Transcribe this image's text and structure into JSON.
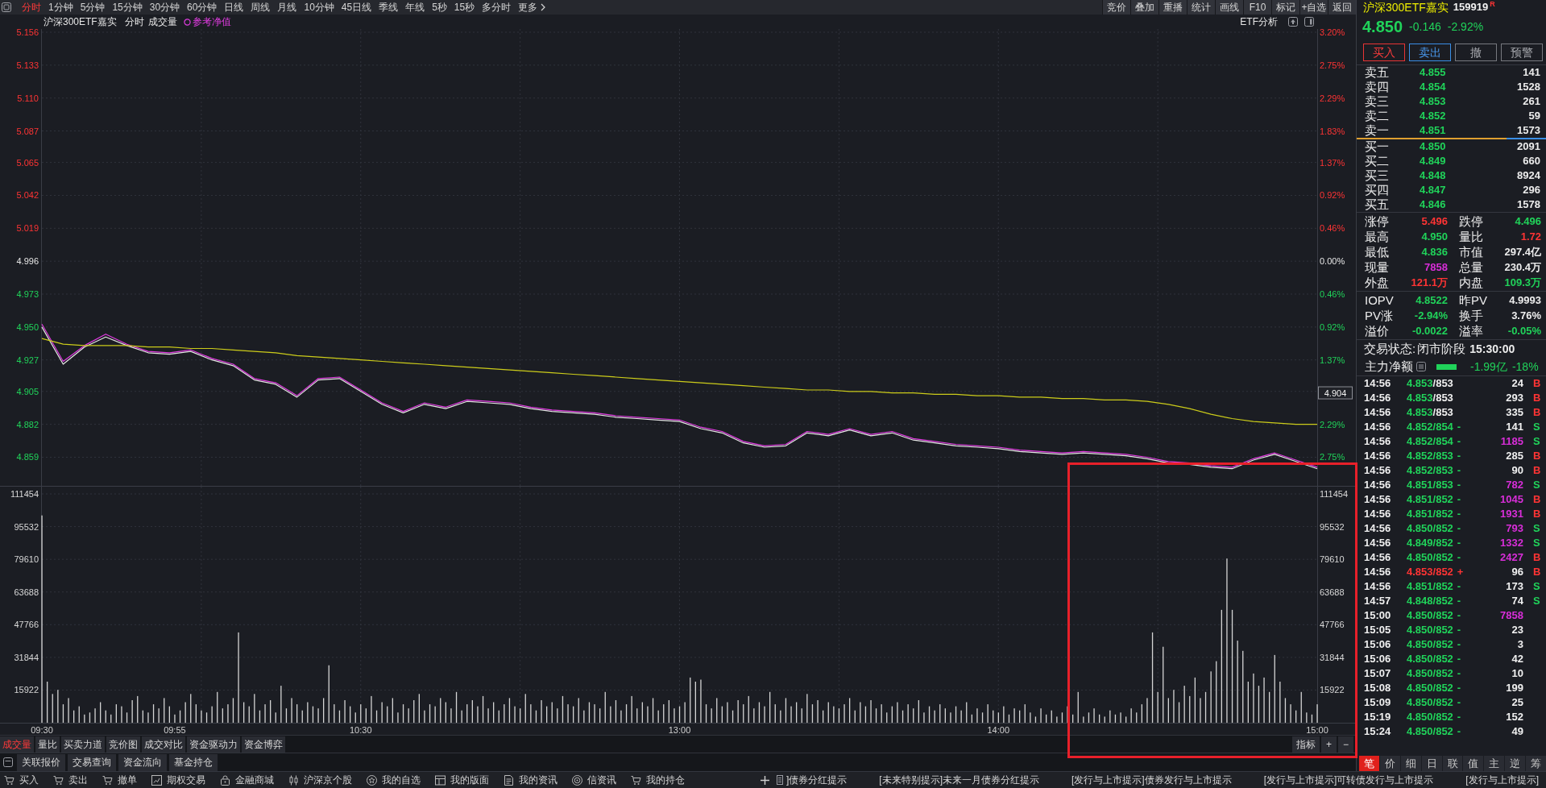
{
  "toolbar": {
    "periods": [
      {
        "label": "分时",
        "selected": true
      },
      {
        "label": "1分钟",
        "selected": false
      },
      {
        "label": "5分钟",
        "selected": false
      },
      {
        "label": "15分钟",
        "selected": false
      },
      {
        "label": "30分钟",
        "selected": false
      },
      {
        "label": "60分钟",
        "selected": false
      },
      {
        "label": "日线",
        "selected": false
      },
      {
        "label": "周线",
        "selected": false
      },
      {
        "label": "月线",
        "selected": false
      },
      {
        "label": "10分钟",
        "selected": false
      },
      {
        "label": "45日线",
        "selected": false
      },
      {
        "label": "季线",
        "selected": false
      },
      {
        "label": "年线",
        "selected": false
      },
      {
        "label": "5秒",
        "selected": false
      },
      {
        "label": "15秒",
        "selected": false
      },
      {
        "label": "多分时",
        "selected": false
      }
    ],
    "more": "更多",
    "actions": [
      "竞价",
      "叠加",
      "重播",
      "统计",
      "画线",
      "F10",
      "标记",
      "+自选",
      "返回"
    ]
  },
  "chart_header": {
    "security": "沪深300ETF嘉实",
    "mode": "分时",
    "analysis": "ETF分析"
  },
  "price_chart": {
    "chart_data": {
      "type": "line",
      "categories": [
        null,
        null,
        null,
        null,
        null,
        null,
        null,
        null,
        null,
        null,
        null,
        null,
        null,
        null,
        null,
        null,
        null,
        null,
        null,
        null,
        null,
        null,
        null,
        null,
        null,
        null,
        null,
        null,
        null,
        null,
        null,
        null,
        null,
        null,
        null,
        null,
        null,
        null,
        null,
        null,
        null,
        null,
        null,
        null,
        null,
        null,
        null,
        null,
        null,
        null,
        null,
        null,
        null,
        null,
        null,
        null,
        null,
        null,
        null,
        null,
        null
      ],
      "series": [
        {
          "color": "#e6e6e6",
          "values": [
            4.95,
            4.924,
            4.936,
            4.943,
            4.937,
            4.932,
            4.931,
            4.933,
            4.927,
            4.923,
            4.913,
            4.91,
            4.901,
            4.913,
            4.914,
            4.905,
            4.896,
            4.89,
            4.896,
            4.893,
            4.898,
            4.897,
            4.896,
            4.893,
            4.891,
            4.89,
            4.889,
            4.887,
            4.886,
            4.885,
            4.884,
            4.879,
            4.876,
            4.869,
            4.866,
            4.867,
            4.876,
            4.874,
            4.878,
            4.874,
            4.876,
            4.871,
            4.869,
            4.867,
            4.866,
            4.865,
            4.863,
            4.862,
            4.861,
            4.862,
            4.861,
            4.86,
            4.858,
            4.855,
            4.854,
            4.852,
            4.851,
            4.857,
            4.861,
            4.856,
            4.851
          ]
        },
        {
          "name": "参考净值",
          "color": "#e03ce0",
          "values": [
            4.952,
            4.926,
            4.937,
            4.945,
            4.938,
            4.933,
            4.932,
            4.934,
            4.928,
            4.924,
            4.914,
            4.911,
            4.902,
            4.914,
            4.915,
            4.906,
            4.897,
            4.891,
            4.897,
            4.894,
            4.899,
            4.898,
            4.897,
            4.894,
            4.892,
            4.891,
            4.89,
            4.888,
            4.887,
            4.886,
            4.885,
            4.88,
            4.877,
            4.87,
            4.867,
            4.868,
            4.877,
            4.875,
            4.879,
            4.875,
            4.877,
            4.872,
            4.87,
            4.868,
            4.867,
            4.866,
            4.864,
            4.863,
            4.862,
            4.863,
            4.862,
            4.861,
            4.859,
            4.856,
            4.855,
            4.853,
            4.852,
            4.858,
            4.862,
            4.857,
            4.852
          ]
        },
        {
          "color": "#cccc1a",
          "values": [
            4.942,
            4.938,
            4.937,
            4.937,
            4.937,
            4.936,
            4.936,
            4.935,
            4.935,
            4.934,
            4.933,
            4.932,
            4.93,
            4.929,
            4.928,
            4.927,
            4.926,
            4.925,
            4.924,
            4.923,
            4.922,
            4.921,
            4.92,
            4.919,
            4.918,
            4.917,
            4.916,
            4.915,
            4.914,
            4.913,
            4.912,
            4.911,
            4.91,
            4.909,
            4.908,
            4.907,
            4.906,
            4.906,
            4.905,
            4.905,
            4.904,
            4.904,
            4.903,
            4.903,
            4.902,
            4.902,
            4.901,
            4.901,
            4.9,
            4.9,
            4.899,
            4.899,
            4.898,
            4.896,
            4.893,
            4.889,
            4.886,
            4.884,
            4.883,
            4.882,
            4.882
          ]
        }
      ],
      "ylim": [
        4.839,
        5.156
      ],
      "yticks": [
        5.156,
        5.133,
        {
          "value": 5.11,
          "label": "5.110"
        },
        5.087,
        5.065,
        5.042,
        5.019,
        4.996,
        4.973,
        {
          "value": 4.95,
          "label": "4.950"
        },
        4.927,
        4.905,
        4.882,
        4.859
      ],
      "grid": true,
      "annotations": [
        {
          "y": 4.904,
          "text": "4.904"
        }
      ]
    },
    "percent_ticks": [
      {
        "label": "3.20%",
        "kind": "up"
      },
      {
        "label": "2.75%",
        "kind": "up"
      },
      {
        "label": "2.29%",
        "kind": "up"
      },
      {
        "label": "1.83%",
        "kind": "up"
      },
      {
        "label": "1.37%",
        "kind": "up"
      },
      {
        "label": "0.92%",
        "kind": "up"
      },
      {
        "label": "0.46%",
        "kind": "up"
      },
      {
        "label": "0.00%",
        "kind": "flat"
      },
      {
        "label": "0.46%",
        "kind": "down"
      },
      {
        "label": "0.92%",
        "kind": "down"
      },
      {
        "label": "1.37%",
        "kind": "down"
      },
      {
        "label": "2.29%",
        "kind": "down"
      },
      {
        "label": "2.75%",
        "kind": "down"
      }
    ]
  },
  "volume_chart": {
    "chart_data": {
      "type": "bar",
      "categories": [
        "09:30",
        null,
        null,
        null,
        null,
        null,
        null,
        null,
        null,
        null,
        null,
        null,
        null,
        null,
        null,
        null,
        null,
        null,
        null,
        null,
        null,
        null,
        null,
        null,
        null,
        "09:55",
        null,
        null,
        null,
        null,
        null,
        null,
        null,
        null,
        null,
        null,
        null,
        null,
        null,
        null,
        null,
        null,
        null,
        null,
        null,
        null,
        null,
        null,
        null,
        null,
        null,
        null,
        null,
        null,
        null,
        null,
        null,
        null,
        null,
        null,
        "10:30",
        null,
        null,
        null,
        null,
        null,
        null,
        null,
        null,
        null,
        null,
        null,
        null,
        null,
        null,
        null,
        null,
        null,
        null,
        null,
        null,
        null,
        null,
        null,
        null,
        null,
        null,
        null,
        null,
        null,
        null,
        null,
        null,
        null,
        null,
        null,
        null,
        null,
        null,
        null,
        null,
        null,
        null,
        null,
        null,
        null,
        null,
        null,
        null,
        null,
        null,
        null,
        null,
        null,
        null,
        null,
        null,
        null,
        null,
        null,
        "13:00",
        null,
        null,
        null,
        null,
        null,
        null,
        null,
        null,
        null,
        null,
        null,
        null,
        null,
        null,
        null,
        null,
        null,
        null,
        null,
        null,
        null,
        null,
        null,
        null,
        null,
        null,
        null,
        null,
        null,
        null,
        null,
        null,
        null,
        null,
        null,
        null,
        null,
        null,
        null,
        null,
        null,
        null,
        null,
        null,
        null,
        null,
        null,
        null,
        null,
        null,
        null,
        null,
        null,
        null,
        null,
        null,
        null,
        null,
        null,
        "14:00",
        null,
        null,
        null,
        null,
        null,
        null,
        null,
        null,
        null,
        null,
        null,
        null,
        null,
        null,
        null,
        null,
        null,
        null,
        null,
        null,
        null,
        null,
        null,
        null,
        null,
        null,
        null,
        null,
        null,
        null,
        null,
        null,
        null,
        null,
        null,
        null,
        null,
        null,
        null,
        null,
        null,
        null,
        null,
        null,
        null,
        null,
        null,
        null,
        null,
        null,
        null,
        null,
        null,
        null,
        null,
        null,
        null,
        null,
        null,
        "15:00"
      ],
      "series": [
        {
          "name": "成交量",
          "color": "#d4d4d4",
          "values": [
            101000,
            20000,
            14000,
            16000,
            9000,
            12000,
            6000,
            8000,
            4000,
            5000,
            7000,
            10000,
            6000,
            4000,
            9000,
            8000,
            5000,
            11000,
            13000,
            6000,
            5000,
            9000,
            7000,
            12000,
            8000,
            4000,
            6000,
            10000,
            14000,
            9000,
            6000,
            5000,
            8000,
            15000,
            7000,
            9000,
            12000,
            44000,
            10000,
            8000,
            14000,
            6000,
            9000,
            11000,
            5000,
            18000,
            7000,
            12000,
            9000,
            6000,
            10000,
            8000,
            7000,
            12000,
            28000,
            9000,
            6000,
            11000,
            8000,
            5000,
            9000,
            7000,
            13000,
            6000,
            10000,
            8000,
            12000,
            5000,
            9000,
            7000,
            11000,
            14000,
            6000,
            9000,
            8000,
            12000,
            10000,
            7000,
            15000,
            6000,
            9000,
            11000,
            8000,
            13000,
            7000,
            10000,
            6000,
            9000,
            12000,
            8000,
            7000,
            14000,
            9000,
            6000,
            11000,
            8000,
            10000,
            7000,
            13000,
            9000,
            8000,
            12000,
            6000,
            10000,
            9000,
            7000,
            15000,
            8000,
            11000,
            6000,
            9000,
            13000,
            7000,
            10000,
            8000,
            12000,
            6000,
            9000,
            11000,
            7000,
            8000,
            10000,
            22000,
            20000,
            21000,
            9000,
            7000,
            12000,
            8000,
            10000,
            6000,
            11000,
            9000,
            13000,
            7000,
            10000,
            8000,
            15000,
            9000,
            6000,
            12000,
            8000,
            10000,
            7000,
            14000,
            9000,
            11000,
            6000,
            10000,
            8000,
            7000,
            9000,
            12000,
            6000,
            10000,
            8000,
            11000,
            7000,
            9000,
            5000,
            8000,
            10000,
            6000,
            9000,
            7000,
            11000,
            5000,
            8000,
            6000,
            9000,
            7000,
            5000,
            8000,
            6000,
            10000,
            4000,
            7000,
            5000,
            9000,
            6000,
            5000,
            8000,
            4000,
            7000,
            6000,
            9000,
            5000,
            3000,
            7000,
            4000,
            6000,
            3000,
            5000,
            8000,
            4000,
            15000,
            3000,
            5000,
            7000,
            4000,
            3000,
            6000,
            4000,
            5000,
            3000,
            7000,
            5000,
            9000,
            12000,
            44000,
            15000,
            37000,
            12000,
            16000,
            10000,
            18000,
            13000,
            22000,
            12000,
            15000,
            25000,
            30000,
            55000,
            80000,
            55000,
            40000,
            35000,
            20000,
            24000,
            18000,
            22000,
            15000,
            33000,
            20000,
            12000,
            9000,
            6000,
            15000,
            5000,
            4000,
            9000
          ]
        }
      ],
      "ylim": [
        0,
        115000
      ],
      "yticks": [
        111454,
        95532,
        79610,
        63688,
        47766,
        31844,
        15922
      ],
      "grid": true
    },
    "left_ticks": [
      "111454",
      "95532",
      "79610",
      "63688",
      "47766",
      "31844",
      "15922"
    ]
  },
  "indicator_tabs": [
    {
      "label": "成交量",
      "selected": true
    },
    {
      "label": "量比",
      "selected": false
    },
    {
      "label": "买卖力道",
      "selected": false
    },
    {
      "label": "竞价图",
      "selected": false
    },
    {
      "label": "成交对比",
      "selected": false
    },
    {
      "label": "资金驱动力",
      "selected": false
    },
    {
      "label": "资金博弈",
      "selected": false
    }
  ],
  "indicator_controls": [
    "指标",
    "+",
    "−"
  ],
  "info_tabs": [
    "关联报价",
    "交易查询",
    "资金流向",
    "基金持仓"
  ],
  "quote": {
    "name": "沪深300ETF嘉实",
    "code": "159919",
    "flag": "R",
    "price": "4.850",
    "change": "-0.146",
    "change_pct": "-2.92%"
  },
  "trade_buttons": [
    {
      "label": "买入",
      "kind": "buy"
    },
    {
      "label": "卖出",
      "kind": "sell"
    },
    {
      "label": "撤",
      "kind": "plain"
    },
    {
      "label": "预警",
      "kind": "plain"
    }
  ],
  "asks": [
    {
      "label": "卖五",
      "price": "4.855",
      "volume": "141"
    },
    {
      "label": "卖四",
      "price": "4.854",
      "volume": "1528"
    },
    {
      "label": "卖三",
      "price": "4.853",
      "volume": "261"
    },
    {
      "label": "卖二",
      "price": "4.852",
      "volume": "59"
    },
    {
      "label": "卖一",
      "price": "4.851",
      "volume": "1573"
    }
  ],
  "book_divider": {
    "level": 0.79
  },
  "bids": [
    {
      "label": "买一",
      "price": "4.850",
      "volume": "2091"
    },
    {
      "label": "买二",
      "price": "4.849",
      "volume": "660"
    },
    {
      "label": "买三",
      "price": "4.848",
      "volume": "8924"
    },
    {
      "label": "买四",
      "price": "4.847",
      "volume": "296"
    },
    {
      "label": "买五",
      "price": "4.846",
      "volume": "1578"
    }
  ],
  "stats": [
    {
      "label": "涨停",
      "value": "5.496",
      "color": "#ff3434"
    },
    {
      "label": "跌停",
      "value": "4.496",
      "color": "#20d35a"
    },
    {
      "label": "最高",
      "value": "4.950",
      "color": "#20d35a"
    },
    {
      "label": "量比",
      "value": "1.72",
      "color": "#ff3434"
    },
    {
      "label": "最低",
      "value": "4.836",
      "color": "#20d35a"
    },
    {
      "label": "市值",
      "value": "297.4亿",
      "color": "#ececec"
    },
    {
      "label": "现量",
      "value": "7858",
      "color": "#d92ed9"
    },
    {
      "label": "总量",
      "value": "230.4万",
      "color": "#ececec"
    },
    {
      "label": "外盘",
      "value": "121.1万",
      "color": "#ff3434"
    },
    {
      "label": "内盘",
      "value": "109.3万",
      "color": "#20d35a"
    }
  ],
  "etf_stats": [
    {
      "label": "IOPV",
      "value": "4.8522",
      "color": "#20d35a"
    },
    {
      "label": "昨PV",
      "value": "4.9993",
      "color": "#ececec"
    },
    {
      "label": "PV涨",
      "value": "-2.94%",
      "color": "#20d35a"
    },
    {
      "label": "换手",
      "value": "3.76%",
      "color": "#ececec"
    },
    {
      "label": "溢价",
      "value": "-0.0022",
      "color": "#20d35a"
    },
    {
      "label": "溢率",
      "value": "-0.05%",
      "color": "#20d35a"
    }
  ],
  "trading_status": {
    "label": "交易状态:",
    "phase": "闭市阶段",
    "time": "15:30:00"
  },
  "net_flow": {
    "label": "主力净额",
    "amount": "-1.99亿",
    "ratio": "-18%"
  },
  "trades": [
    {
      "time": "14:56",
      "price": "4.853",
      "color": "#20d35a",
      "suffix": "/853",
      "volume": "24",
      "large": false,
      "side": "B",
      "buy": true
    },
    {
      "time": "14:56",
      "price": "4.853",
      "color": "#20d35a",
      "suffix": "/853",
      "volume": "293",
      "large": false,
      "side": "B",
      "buy": true
    },
    {
      "time": "14:56",
      "price": "4.853",
      "color": "#20d35a",
      "suffix": "/853",
      "volume": "335",
      "large": false,
      "side": "B",
      "buy": true
    },
    {
      "time": "14:56",
      "price": "4.852",
      "color": "#20d35a",
      "suffix": "/854",
      "mark": "-",
      "volume": "141",
      "large": false,
      "side": "S",
      "buy": false
    },
    {
      "time": "14:56",
      "price": "4.852",
      "color": "#20d35a",
      "suffix": "/854",
      "mark": "-",
      "volume": "1185",
      "large": true,
      "side": "S",
      "buy": false
    },
    {
      "time": "14:56",
      "price": "4.852",
      "color": "#20d35a",
      "suffix": "/853",
      "mark": "-",
      "volume": "285",
      "large": false,
      "side": "B",
      "buy": true
    },
    {
      "time": "14:56",
      "price": "4.852",
      "color": "#20d35a",
      "suffix": "/853",
      "mark": "-",
      "volume": "90",
      "large": false,
      "side": "B",
      "buy": true
    },
    {
      "time": "14:56",
      "price": "4.851",
      "color": "#20d35a",
      "suffix": "/853",
      "mark": "-",
      "volume": "782",
      "large": true,
      "side": "S",
      "buy": false
    },
    {
      "time": "14:56",
      "price": "4.851",
      "color": "#20d35a",
      "suffix": "/852",
      "mark": "-",
      "volume": "1045",
      "large": true,
      "side": "B",
      "buy": true
    },
    {
      "time": "14:56",
      "price": "4.851",
      "color": "#20d35a",
      "suffix": "/852",
      "mark": "-",
      "volume": "1931",
      "large": true,
      "side": "B",
      "buy": true
    },
    {
      "time": "14:56",
      "price": "4.850",
      "color": "#20d35a",
      "suffix": "/852",
      "mark": "-",
      "volume": "793",
      "large": true,
      "side": "S",
      "buy": false
    },
    {
      "time": "14:56",
      "price": "4.849",
      "color": "#20d35a",
      "suffix": "/852",
      "mark": "-",
      "volume": "1332",
      "large": true,
      "side": "S",
      "buy": false
    },
    {
      "time": "14:56",
      "price": "4.850",
      "color": "#20d35a",
      "suffix": "/852",
      "mark": "-",
      "volume": "2427",
      "large": true,
      "side": "B",
      "buy": true
    },
    {
      "time": "14:56",
      "price": "4.853",
      "color": "#ff3434",
      "suffix": "/852",
      "mark": "+",
      "volume": "96",
      "large": false,
      "side": "B",
      "buy": true
    },
    {
      "time": "14:56",
      "price": "4.851",
      "color": "#20d35a",
      "suffix": "/852",
      "mark": "-",
      "volume": "173",
      "large": false,
      "side": "S",
      "buy": false
    },
    {
      "time": "14:57",
      "price": "4.848",
      "color": "#20d35a",
      "suffix": "/852",
      "mark": "-",
      "volume": "74",
      "large": false,
      "side": "S",
      "buy": false
    },
    {
      "time": "15:00",
      "price": "4.850",
      "color": "#20d35a",
      "suffix": "/852",
      "mark": "-",
      "volume": "7858",
      "large": true
    },
    {
      "time": "15:05",
      "price": "4.850",
      "color": "#20d35a",
      "suffix": "/852",
      "mark": "-",
      "volume": "23",
      "large": false
    },
    {
      "time": "15:06",
      "price": "4.850",
      "color": "#20d35a",
      "suffix": "/852",
      "mark": "-",
      "volume": "3",
      "large": false
    },
    {
      "time": "15:06",
      "price": "4.850",
      "color": "#20d35a",
      "suffix": "/852",
      "mark": "-",
      "volume": "42",
      "large": false
    },
    {
      "time": "15:07",
      "price": "4.850",
      "color": "#20d35a",
      "suffix": "/852",
      "mark": "-",
      "volume": "10",
      "large": false
    },
    {
      "time": "15:08",
      "price": "4.850",
      "color": "#20d35a",
      "suffix": "/852",
      "mark": "-",
      "volume": "199",
      "large": false
    },
    {
      "time": "15:09",
      "price": "4.850",
      "color": "#20d35a",
      "suffix": "/852",
      "mark": "-",
      "volume": "25",
      "large": false
    },
    {
      "time": "15:19",
      "price": "4.850",
      "color": "#20d35a",
      "suffix": "/852",
      "mark": "-",
      "volume": "152",
      "large": false
    },
    {
      "time": "15:24",
      "price": "4.850",
      "color": "#20d35a",
      "suffix": "/852",
      "mark": "-",
      "volume": "49",
      "large": false
    }
  ],
  "detail_tabs": [
    {
      "label": "笔",
      "selected": true
    },
    {
      "label": "价",
      "selected": false
    },
    {
      "label": "细",
      "selected": false
    },
    {
      "label": "日",
      "selected": false
    },
    {
      "label": "联",
      "selected": false
    },
    {
      "label": "值",
      "selected": false
    },
    {
      "label": "主",
      "selected": false
    },
    {
      "label": "逆",
      "selected": false
    },
    {
      "label": "筹",
      "selected": false
    }
  ],
  "taskbar": [
    {
      "label": "买入",
      "kind": "cart"
    },
    {
      "label": "卖出",
      "kind": "cart"
    },
    {
      "label": "撤单",
      "kind": "cart"
    },
    {
      "label": "期权交易",
      "kind": "chart"
    },
    {
      "label": "金融商城",
      "kind": "lock"
    },
    {
      "label": "沪深京个股",
      "kind": "candles"
    },
    {
      "label": "我的自选",
      "kind": "star"
    },
    {
      "label": "我的版面",
      "kind": "layout"
    },
    {
      "label": "我的资讯",
      "kind": "document"
    },
    {
      "label": "信资讯",
      "kind": "target"
    },
    {
      "label": "我的持仓",
      "kind": "cart"
    }
  ],
  "ticker": [
    "]债券分红提示",
    "[未来特别提示]未来一月债券分红提示",
    "[发行与上市提示]债券发行与上市提示",
    "[发行与上市提示]可转债发行与上市提示",
    "[发行与上市提示]"
  ]
}
